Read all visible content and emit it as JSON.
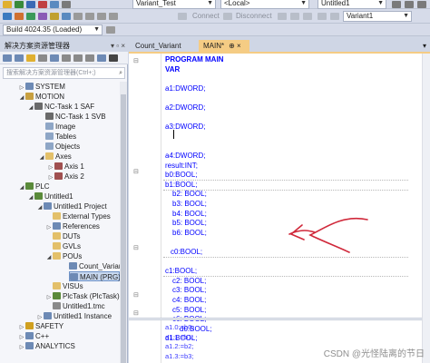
{
  "toolbar": {
    "variant_combo": "Variant_Test",
    "target_combo": "<Local>",
    "project_combo": "Untitled1",
    "connect_label": "Connect",
    "disconnect_label": "Disconnect",
    "build_combo": "Build 4024.35 (Loaded)",
    "variant_right_combo": "Variant1"
  },
  "solution_explorer": {
    "title": "解决方案资源管理器",
    "pin_glyphs": "▾ ▫ ×",
    "search_placeholder": "搜索解决方案资源管理器(Ctrl+;)",
    "tree": [
      {
        "label": "SYSTEM",
        "icon": "folder-icon",
        "color": "#6d8ab5"
      },
      {
        "label": "MOTION",
        "icon": "motion-icon",
        "color": "#c8a040"
      },
      {
        "label": "NC-Task 1 SAF",
        "icon": "task-icon",
        "color": "#6a6a6a"
      },
      {
        "label": "NC-Task 1 SVB",
        "icon": "task-icon",
        "color": "#6a6a6a"
      },
      {
        "label": "Image",
        "icon": "image-icon",
        "color": "#8ea6c6"
      },
      {
        "label": "Tables",
        "icon": "table-icon",
        "color": "#8ea6c6"
      },
      {
        "label": "Objects",
        "icon": "object-icon",
        "color": "#8ea6c6"
      },
      {
        "label": "Axes",
        "icon": "folder-icon",
        "color": "#e3c06a"
      },
      {
        "label": "Axis 1",
        "icon": "axis-icon",
        "color": "#a05050"
      },
      {
        "label": "Axis 2",
        "icon": "axis-icon",
        "color": "#a05050"
      },
      {
        "label": "PLC",
        "icon": "plc-icon",
        "color": "#5a8a3a"
      },
      {
        "label": "Untitled1",
        "icon": "project-icon",
        "color": "#5a8a3a"
      },
      {
        "label": "Untitled1 Project",
        "icon": "project-icon",
        "color": "#6d8ab5"
      },
      {
        "label": "External Types",
        "icon": "folder-icon",
        "color": "#e3c06a"
      },
      {
        "label": "References",
        "icon": "reference-icon",
        "color": "#6d8ab5"
      },
      {
        "label": "DUTs",
        "icon": "folder-icon",
        "color": "#e3c06a"
      },
      {
        "label": "GVLs",
        "icon": "folder-icon",
        "color": "#e3c06a"
      },
      {
        "label": "POUs",
        "icon": "folder-icon",
        "color": "#e3c06a"
      },
      {
        "label": "Count_Varian",
        "icon": "pou-icon",
        "color": "#6d8ab5"
      },
      {
        "label": "MAIN (PRG)",
        "icon": "pou-icon",
        "color": "#6d8ab5"
      },
      {
        "label": "VISUs",
        "icon": "folder-icon",
        "color": "#e3c06a"
      },
      {
        "label": "PlcTask (PlcTask)",
        "icon": "plctask-icon",
        "color": "#5a8a3a"
      },
      {
        "label": "Untitled1.tmc",
        "icon": "file-icon",
        "color": "#8a8a8a"
      },
      {
        "label": "Untitled1 Instance",
        "icon": "instance-icon",
        "color": "#6d8ab5"
      },
      {
        "label": "SAFETY",
        "icon": "safety-icon",
        "color": "#d0a020"
      },
      {
        "label": "C++",
        "icon": "cpp-icon",
        "color": "#6d8ab5"
      },
      {
        "label": "ANALYTICS",
        "icon": "analytics-icon",
        "color": "#6d8ab5"
      }
    ]
  },
  "editor": {
    "tabs": [
      {
        "label": "Count_Variant",
        "active": false
      },
      {
        "label": "MAIN*",
        "active": true,
        "close": "⊕ ×"
      }
    ],
    "declaration_lines": [
      "PROGRAM MAIN",
      "VAR",
      "",
      "a1:DWORD;",
      "",
      "a2:DWORD;",
      "",
      "a3:DWORD;",
      "",
      "",
      "a4:DWORD;",
      "result:INT;",
      "b0:BOOL;",
      "b1:BOOL;",
      "b2: BOOL;",
      "b3: BOOL;",
      "b4: BOOL;",
      "b5: BOOL;",
      "b6: BOOL;",
      "",
      "c0:BOOL;",
      "",
      "c1:BOOL;",
      "c2: BOOL;",
      "c3: BOOL;",
      "c4: BOOL;",
      "c5: BOOL;",
      "c6: BOOL;",
      "d0:BOOL;",
      "d1:BOOL;"
    ],
    "code_lines": [
      "a1.0:=b0;",
      "a1.1:=b1;",
      "a1.2:=b2;",
      "a1.3:=b3;"
    ]
  },
  "watermark": "CSDN @光怪陆离的节日"
}
